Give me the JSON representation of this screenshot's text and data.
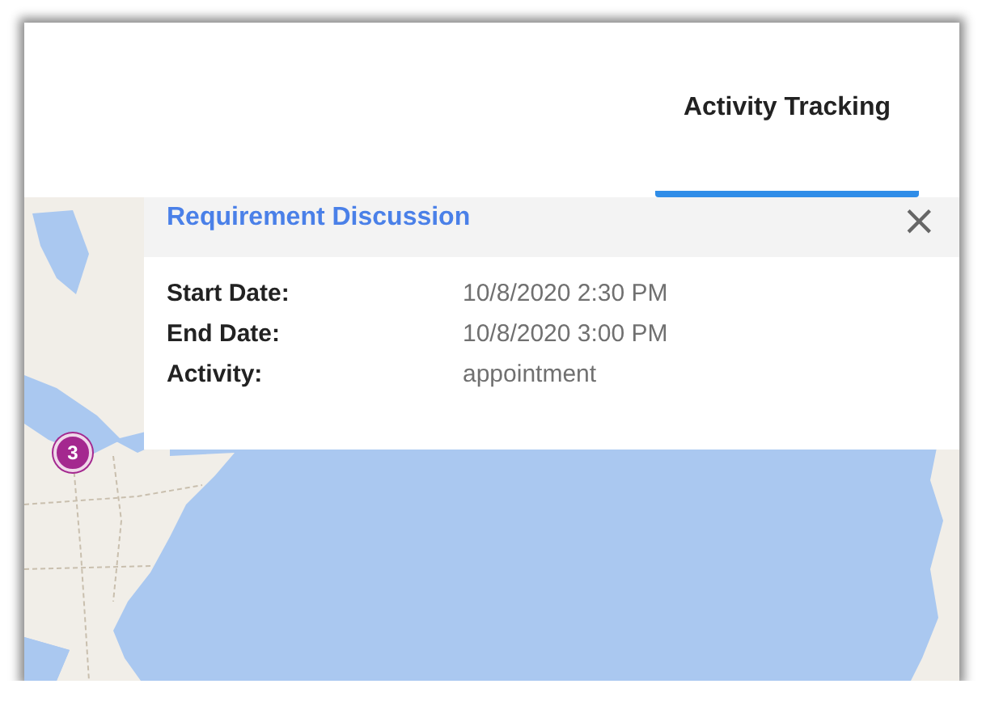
{
  "header": {
    "tabs": [
      {
        "label": "Activity Tracking",
        "selected": true
      }
    ]
  },
  "map": {
    "markers": [
      {
        "count": "3"
      }
    ]
  },
  "popup": {
    "title": "Requirement Discussion",
    "close": "×",
    "fields": [
      {
        "label": "Start Date:",
        "value": "10/8/2020 2:30 PM"
      },
      {
        "label": "End Date:",
        "value": "10/8/2020 3:00 PM"
      },
      {
        "label": "Activity:",
        "value": "appointment"
      }
    ]
  }
}
